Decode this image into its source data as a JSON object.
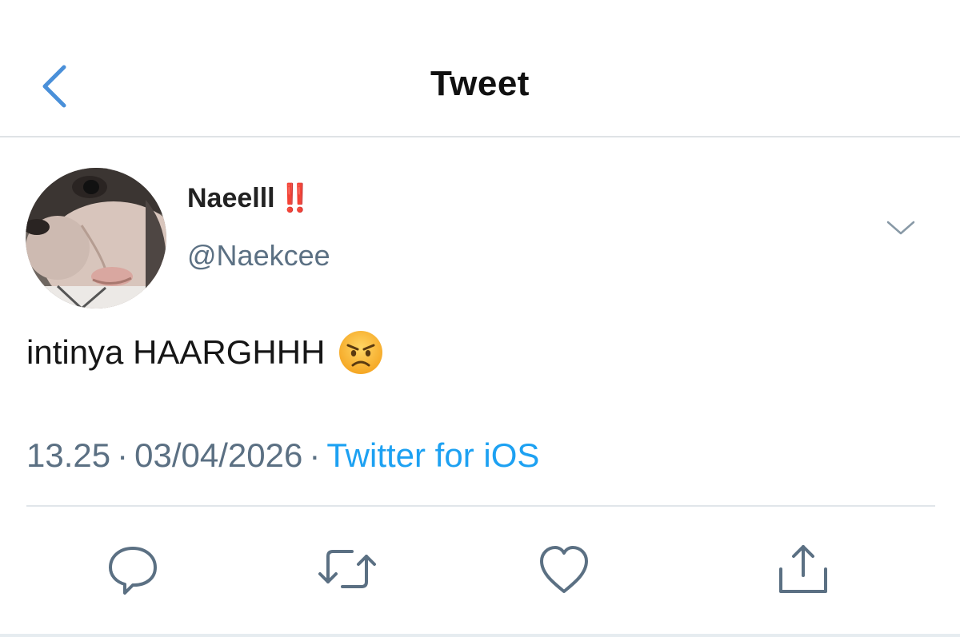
{
  "header": {
    "title": "Tweet",
    "back_icon": "chevron-left-icon"
  },
  "author": {
    "display_name": "Naeelll",
    "badge": "‼️",
    "username": "@Naekcee"
  },
  "tweet": {
    "text": "intinya HAARGHHH",
    "emoji": "angry-face-emoji"
  },
  "meta": {
    "time": "13.25",
    "separator": "·",
    "date": "03/04/2026",
    "source": "Twitter for iOS"
  },
  "actions": [
    {
      "name": "reply",
      "icon": "reply-icon"
    },
    {
      "name": "retweet",
      "icon": "retweet-icon"
    },
    {
      "name": "like",
      "icon": "heart-icon"
    },
    {
      "name": "share",
      "icon": "share-icon"
    }
  ],
  "colors": {
    "accent": "#1da1f2",
    "back_icon": "#4a90d9",
    "secondary_text": "#5b7083",
    "badge": "#e0352b",
    "divider": "#e1e6ea"
  }
}
